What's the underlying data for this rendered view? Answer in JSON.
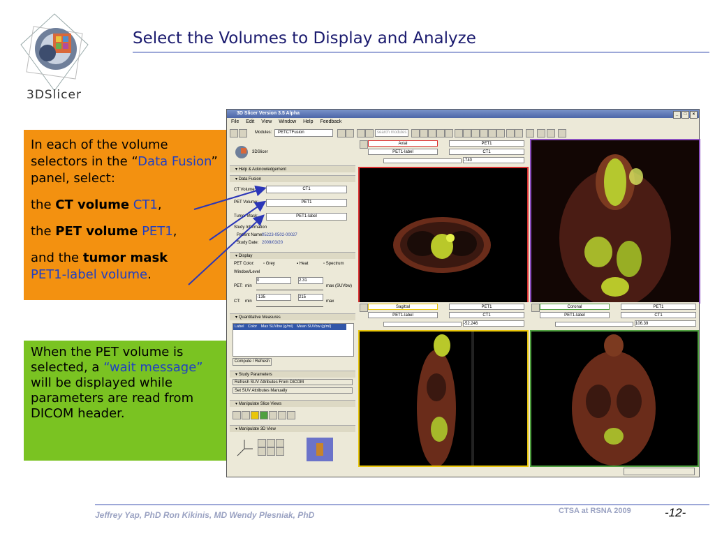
{
  "slide": {
    "title": "Select the Volumes to Display and Analyze",
    "logo_text": "3DSlicer",
    "footer_authors": "Jeffrey Yap, PhD    Ron Kikinis, MD    Wendy Plesniak, PhD",
    "footer_conference": "CTSA at RSNA 2009",
    "page_number": "-12-"
  },
  "orange_box": {
    "p1_a": "In each of the volume selectors in the “",
    "p1_blue": "Data Fusion",
    "p1_b": "” panel, select:",
    "p2_a": "the ",
    "p2_bold": "CT volume",
    "p2_blue": " CT1",
    "p2_end": ",",
    "p3_a": "the ",
    "p3_bold": "PET volume",
    "p3_blue": " PET1",
    "p3_end": ",",
    "p4_a": "and the ",
    "p4_bold": "tumor mask",
    "p4_blue": "PET1-label volume",
    "p4_end": "."
  },
  "green_box": {
    "a": "When the PET volume is selected, a ",
    "blue": "“wait message”",
    "b": " will be displayed while parameters are read from DICOM header."
  },
  "app": {
    "window_title": "3D Slicer Version 3.5 Alpha",
    "menu": [
      "File",
      "Edit",
      "View",
      "Window",
      "Help",
      "Feedback"
    ],
    "modules_label": "Modules:",
    "module_selected": "PETCTFusion",
    "search_placeholder": "search modules",
    "left": {
      "slicer_label": "3DSlicer",
      "help_section": "Help & Acknowledgement",
      "data_fusion_section": "Data Fusion",
      "ct_volume_label": "CT Volume:",
      "ct_volume_value": "CT1",
      "pet_volume_label": "PET Volume:",
      "pet_volume_value": "PET1",
      "tumor_mask_label": "Tumor Mask:",
      "tumor_mask_value": "PET1-label",
      "study_info_label": "Study Information",
      "patient_name_label": "Patient Name:",
      "patient_name_value": "05223-0502-00027",
      "study_date_label": "Study Date:",
      "study_date_value": "2009/03/20",
      "display_section": "Display",
      "pet_color_label": "PET Color:",
      "color_options": [
        "Grey",
        "Heat",
        "Spectrum"
      ],
      "window_level_label": "Window/Level",
      "pet_label": "PET:",
      "min_label": "min",
      "pet_min": "0",
      "pet_max": "2.31",
      "pet_max_label": "max (SUVbw)",
      "ct_label": "CT:",
      "ct_min": "-135",
      "ct_max": "215",
      "ct_max_label": "max",
      "quant_section": "Quantitative Measures",
      "table_headers": [
        "Label",
        "Color",
        "Max SUVbw (g/ml)",
        "Mean SUVbw (g/ml)"
      ],
      "compute_button": "Compute / Refresh",
      "study_params_section": "Study Parameters",
      "refresh_suv": "Refresh SUV Attributes From DICOM",
      "set_suv": "Set SUV Attributes Manually",
      "manip_slice_section": "Manipulate Slice Views",
      "manip_3d_section": "Manipulate 3D View"
    },
    "views": {
      "axial": {
        "name": "Axial",
        "fg": "PET1",
        "label": "PET1-label",
        "bg": "CT1",
        "offset": "-740"
      },
      "sagittal": {
        "name": "Sagittal",
        "fg": "PET1",
        "label": "PET1-label",
        "bg": "CT1",
        "offset": "-52.246"
      },
      "coronal": {
        "name": "Coronal",
        "fg": "PET1",
        "label": "PET1-label",
        "bg": "CT1",
        "offset": "106.39"
      }
    }
  }
}
